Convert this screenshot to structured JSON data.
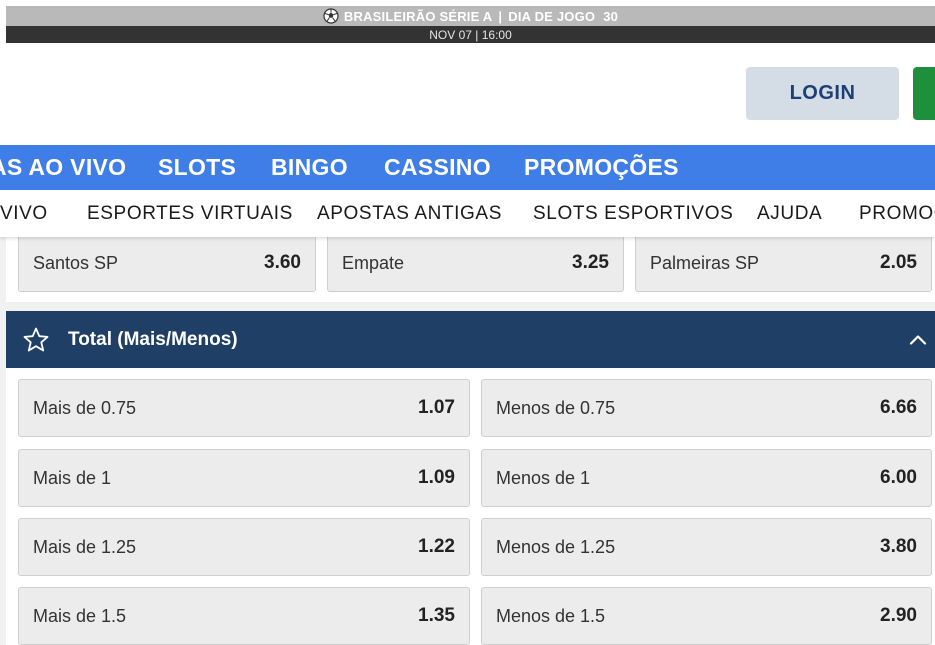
{
  "match": {
    "league": "BRASILEIRÃO SÉRIE A",
    "separator": "|",
    "matchday_label": "DIA DE JOGO",
    "matchday": "30",
    "datetime": "NOV 07 | 16:00",
    "league_icon": "soccer-ball-icon"
  },
  "header": {
    "login_label": "LOGIN"
  },
  "main_nav": {
    "items": [
      "AS AO VIVO",
      "SLOTS",
      "BINGO",
      "CASSINO",
      "PROMOÇÕES"
    ]
  },
  "sub_nav": {
    "items": [
      "VIVO",
      "ESPORTES VIRTUAIS",
      "APOSTAS ANTIGAS",
      "SLOTS ESPORTIVOS",
      "AJUDA",
      "PROMOÇ"
    ]
  },
  "result_market": {
    "outcomes": [
      {
        "label": "Santos SP",
        "price": "3.60"
      },
      {
        "label": "Empate",
        "price": "3.25"
      },
      {
        "label": "Palmeiras SP",
        "price": "2.05"
      }
    ]
  },
  "total_market": {
    "title": "Total (Mais/Menos)",
    "icons": {
      "favorite": "star-icon",
      "collapse": "chevron-up-icon"
    },
    "rows": [
      {
        "over_label": "Mais de 0.75",
        "over_price": "1.07",
        "under_label": "Menos de 0.75",
        "under_price": "6.66"
      },
      {
        "over_label": "Mais de 1",
        "over_price": "1.09",
        "under_label": "Menos de 1",
        "under_price": "6.00"
      },
      {
        "over_label": "Mais de 1.25",
        "over_price": "1.22",
        "under_label": "Menos de 1.25",
        "under_price": "3.80"
      },
      {
        "over_label": "Mais de 1.5",
        "over_price": "1.35",
        "under_label": "Menos de 1.5",
        "under_price": "2.90"
      }
    ]
  },
  "colors": {
    "nav_blue": "#3f7ee6",
    "market_header": "#1f3f66",
    "login_bg": "#d4dce6",
    "login_text": "#1e3f75",
    "register_green": "#1e8f3b"
  }
}
